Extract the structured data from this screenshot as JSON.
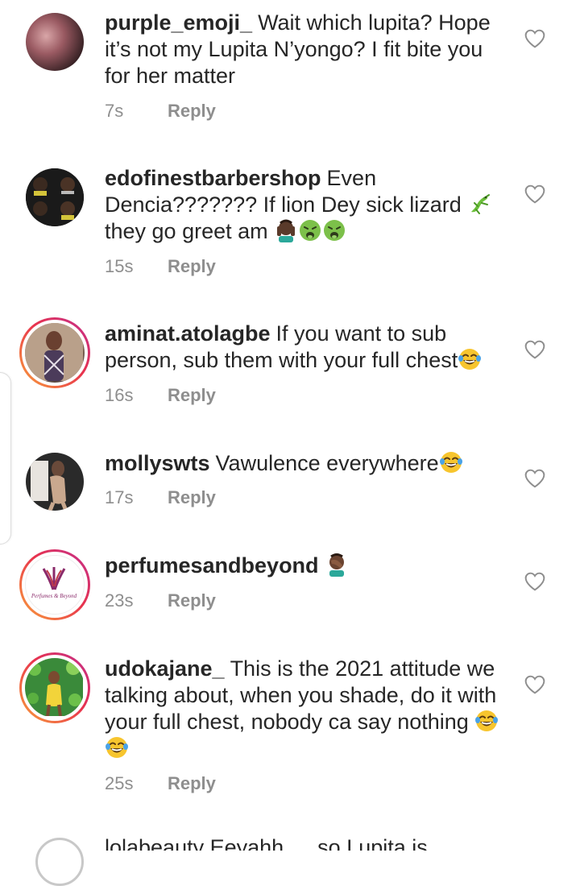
{
  "comments": [
    {
      "username": "purple_emoji_",
      "text": "Wait which lupita? Hope it’s not my Lupita  N’yongo? I fit bite you for her matter",
      "time": "7s",
      "reply": "Reply"
    },
    {
      "username": "edofinestbarbershop",
      "text": "Even Dencia??????? If lion Dey sick lizard",
      "text2": "they go greet am",
      "time": "15s",
      "reply": "Reply"
    },
    {
      "username": "aminat.atolagbe",
      "text": "If you want to sub person, sub them with your full chest",
      "time": "16s",
      "reply": "Reply"
    },
    {
      "username": "mollyswts",
      "text": "Vawulence everywhere",
      "time": "17s",
      "reply": "Reply"
    },
    {
      "username": "perfumesandbeyond",
      "text": "",
      "time": "23s",
      "reply": "Reply",
      "avatar_text": "Perfumes & Beyond"
    },
    {
      "username": "udokajane_",
      "text": "This is the 2021 attitude we talking about, when you shade, do it with your full chest, nobody ca say nothing",
      "time": "25s",
      "reply": "Reply"
    }
  ],
  "partial_comment": {
    "text": "lolabeauty  Eeyahh … so Lupita is"
  },
  "icons": {
    "like": "heart-outline-icon",
    "lizard": "lizard-emoji",
    "facepalm": "facepalm-emoji",
    "nauseated": "nauseated-face-emoji",
    "laughing": "tears-of-joy-emoji"
  },
  "colors": {
    "text": "#262626",
    "meta": "#8e8e8e",
    "ring_start": "#f9a13a",
    "ring_end": "#c22f8e"
  }
}
